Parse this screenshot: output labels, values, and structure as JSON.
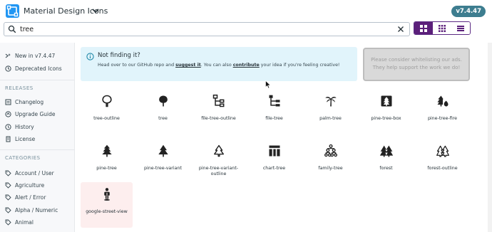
{
  "header": {
    "app_title": "Material Design Icons",
    "version": "v7.4.47"
  },
  "search": {
    "value": "tree"
  },
  "view_modes": [
    "grid-large",
    "grid-medium",
    "list"
  ],
  "sidebar": {
    "top_items": [
      {
        "label": "New in v7.4.47",
        "icon": "new-icon"
      },
      {
        "label": "Deprecated Icons",
        "icon": "deprecated-icon"
      }
    ],
    "releases_heading": "RELEASES",
    "release_items": [
      {
        "label": "Changelog",
        "icon": "changelog-icon"
      },
      {
        "label": "Upgrade Guide",
        "icon": "upgrade-icon"
      },
      {
        "label": "History",
        "icon": "history-icon"
      },
      {
        "label": "License",
        "icon": "license-icon"
      }
    ],
    "categories_heading": "CATEGORIES",
    "category_items": [
      {
        "label": "Account / User",
        "icon": "tag-icon"
      },
      {
        "label": "Agriculture",
        "icon": "tag-icon"
      },
      {
        "label": "Alert / Error",
        "icon": "tag-icon"
      },
      {
        "label": "Alpha / Numeric",
        "icon": "tag-icon"
      },
      {
        "label": "Animal",
        "icon": "tag-icon"
      }
    ]
  },
  "notice": {
    "title": "Not finding it?",
    "body_1": "Head over to our GitHub repo and ",
    "link_1": "suggest it",
    "body_2": ". You can also ",
    "link_2": "contribute",
    "body_3": " your idea if you're feeling creative!"
  },
  "ad": {
    "line_1": "Please consider whitelisting our ads.",
    "line_2": "They help support the work we do!"
  },
  "icons": [
    {
      "name": "tree-outline"
    },
    {
      "name": "tree"
    },
    {
      "name": "file-tree-outline"
    },
    {
      "name": "file-tree"
    },
    {
      "name": "palm-tree"
    },
    {
      "name": "pine-tree-box"
    },
    {
      "name": "pine-tree-fire"
    },
    {
      "name": "pine-tree"
    },
    {
      "name": "pine-tree-variant"
    },
    {
      "name": "pine-tree-variant-outline"
    },
    {
      "name": "chart-tree"
    },
    {
      "name": "family-tree"
    },
    {
      "name": "forest"
    },
    {
      "name": "forest-outline"
    },
    {
      "name": "google-street-view"
    }
  ],
  "colors": {
    "accent": "#5b1f7a",
    "logo": "#2196f3",
    "badge": "#3d7d8f",
    "notice_bg": "#e1f4fb",
    "highlight": "#fdeeee"
  }
}
